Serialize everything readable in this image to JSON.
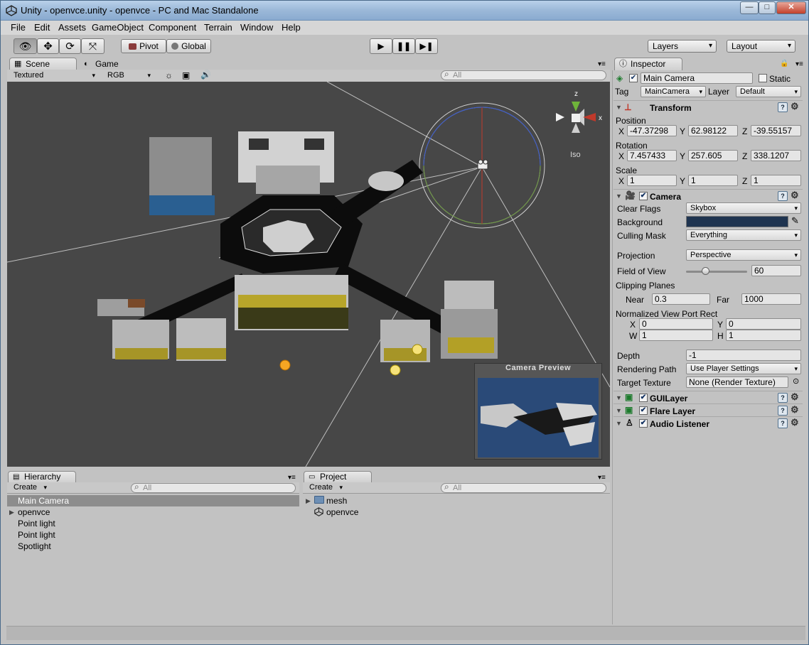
{
  "window": {
    "title": "Unity - openvce.unity - openvce - PC and Mac Standalone"
  },
  "menu": [
    "File",
    "Edit",
    "Assets",
    "GameObject",
    "Component",
    "Terrain",
    "Window",
    "Help"
  ],
  "toolbar": {
    "pivot": "Pivot",
    "global": "Global",
    "layers": "Layers",
    "layout": "Layout"
  },
  "scene": {
    "tab_scene": "Scene",
    "tab_game": "Game",
    "render_mode": "Textured",
    "color_mode": "RGB",
    "search_placeholder": "All",
    "gizmo_label": "Iso",
    "gizmo_axes": {
      "x": "x",
      "z": "z"
    },
    "camera_preview_title": "Camera Preview"
  },
  "hierarchy": {
    "tab": "Hierarchy",
    "create": "Create",
    "search_placeholder": "All",
    "items": [
      "Main Camera",
      "openvce",
      "Point light",
      "Point light",
      "Spotlight"
    ]
  },
  "project": {
    "tab": "Project",
    "create": "Create",
    "search_placeholder": "All",
    "items": [
      "mesh",
      "openvce"
    ]
  },
  "inspector": {
    "tab": "Inspector",
    "object_name": "Main Camera",
    "static_label": "Static",
    "tag_label": "Tag",
    "tag_value": "MainCamera",
    "layer_label": "Layer",
    "layer_value": "Default",
    "transform": {
      "title": "Transform",
      "position_label": "Position",
      "rotation_label": "Rotation",
      "scale_label": "Scale",
      "axis_labels": [
        "X",
        "Y",
        "Z"
      ],
      "position": [
        "-47.37298",
        "62.98122",
        "-39.55157"
      ],
      "rotation": [
        "7.457433",
        "257.605",
        "338.1207"
      ],
      "scale": [
        "1",
        "1",
        "1"
      ]
    },
    "camera": {
      "title": "Camera",
      "clear_flags_label": "Clear Flags",
      "clear_flags": "Skybox",
      "background_label": "Background",
      "background_color": "#1f3450",
      "culling_mask_label": "Culling Mask",
      "culling_mask": "Everything",
      "projection_label": "Projection",
      "projection": "Perspective",
      "fov_label": "Field of View",
      "fov": "60",
      "fov_fraction": 0.33,
      "clipping_label": "Clipping Planes",
      "near_label": "Near",
      "near": "0.3",
      "far_label": "Far",
      "far": "1000",
      "viewport_label": "Normalized View Port Rect",
      "viewport_labels": [
        "X",
        "Y",
        "W",
        "H"
      ],
      "viewport": [
        "0",
        "0",
        "1",
        "1"
      ],
      "depth_label": "Depth",
      "depth": "-1",
      "rendering_path_label": "Rendering Path",
      "rendering_path": "Use Player Settings",
      "target_texture_label": "Target Texture",
      "target_texture": "None (Render Texture)"
    },
    "components": [
      "GUILayer",
      "Flare Layer",
      "Audio Listener"
    ]
  }
}
